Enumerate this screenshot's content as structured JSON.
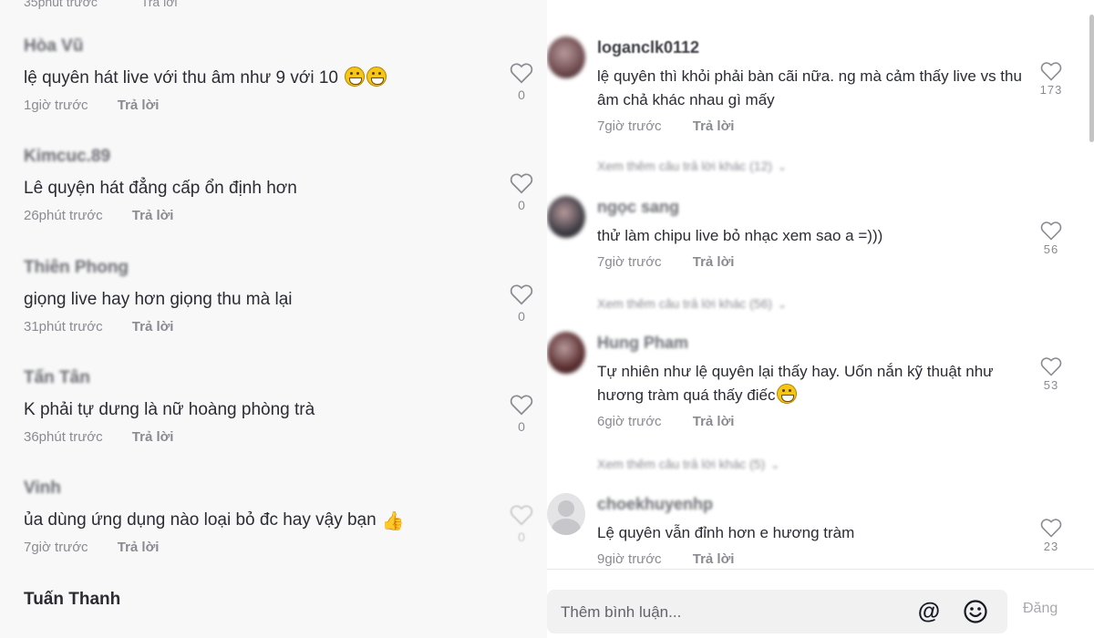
{
  "left_panel": {
    "top_cut": {
      "time": "35phút trước",
      "reply": "Trả lời"
    },
    "comments": [
      {
        "username": "Hòa Vũ",
        "text": "lệ quyên hát live với thu âm như 9 với 10",
        "emoji": "grinning-face-emoji",
        "time": "1giờ trước",
        "reply": "Trả lời",
        "likes": "0"
      },
      {
        "username": "Kimcuc.89",
        "text": "Lê quyện hát đẳng cấp ổn định hơn",
        "time": "26phút trước",
        "reply": "Trả lời",
        "likes": "0"
      },
      {
        "username": "Thiên Phong",
        "text": "giọng live hay hơn giọng thu mà lại",
        "time": "31phút trước",
        "reply": "Trả lời",
        "likes": "0"
      },
      {
        "username": "Tấn Tân",
        "text": "K phải tự dưng là nữ hoàng phòng trà",
        "time": "36phút trước",
        "reply": "Trả lời",
        "likes": "0"
      },
      {
        "username": "Vinh",
        "text": "ủa dùng ứng dụng nào loại bỏ đc hay vậy bạn",
        "emoji": "thumbs-up-emoji",
        "time": "7giờ trước",
        "reply": "Trả lời",
        "likes": "0"
      },
      {
        "username": "Tuấn Thanh"
      }
    ]
  },
  "right_panel": {
    "comments": [
      {
        "username": "loganclk0112",
        "text": "lệ quyên thì khỏi phải bàn cãi nữa. ng mà cảm thấy live vs thu âm chả khác nhau gì mấy",
        "time": "7giờ trước",
        "reply": "Trả lời",
        "likes": "173",
        "view_more": "Xem thêm câu trả lời khác (12)",
        "avatar_color": "#6e4a4e"
      },
      {
        "username": "ngọc sang",
        "text": "thử làm chipu live bỏ nhạc xem sao a =)))",
        "time": "7giờ trước",
        "reply": "Trả lời",
        "likes": "56",
        "view_more": "Xem thêm câu trả lời khác (56)",
        "avatar_color": "#3e3d45"
      },
      {
        "username": "Hung Pham",
        "text": "Tự nhiên như lệ quyên lại thấy hay. Uốn nắn kỹ thuật như hương tràm quá thấy điếc",
        "time": "6giờ trước",
        "reply": "Trả lời",
        "likes": "53",
        "view_more": "Xem thêm câu trả lời khác (5)",
        "avatar_color": "#5a2e30"
      },
      {
        "username": "choekhuyenhp",
        "text": "Lệ quyên vẫn đỉnh hơn e hương tràm",
        "time": "9giờ trước",
        "reply": "Trả lời",
        "likes": "23"
      }
    ]
  },
  "comment_bar": {
    "placeholder": "Thêm bình luận...",
    "mention_icon": "at-sign-icon",
    "emoji_icon": "smiley-icon",
    "post_label": "Đăng"
  },
  "colors": {
    "text": "#2b2c33",
    "muted": "#8a8b91",
    "left_bg": "#f8f8f8",
    "right_bg": "#ffffff"
  }
}
